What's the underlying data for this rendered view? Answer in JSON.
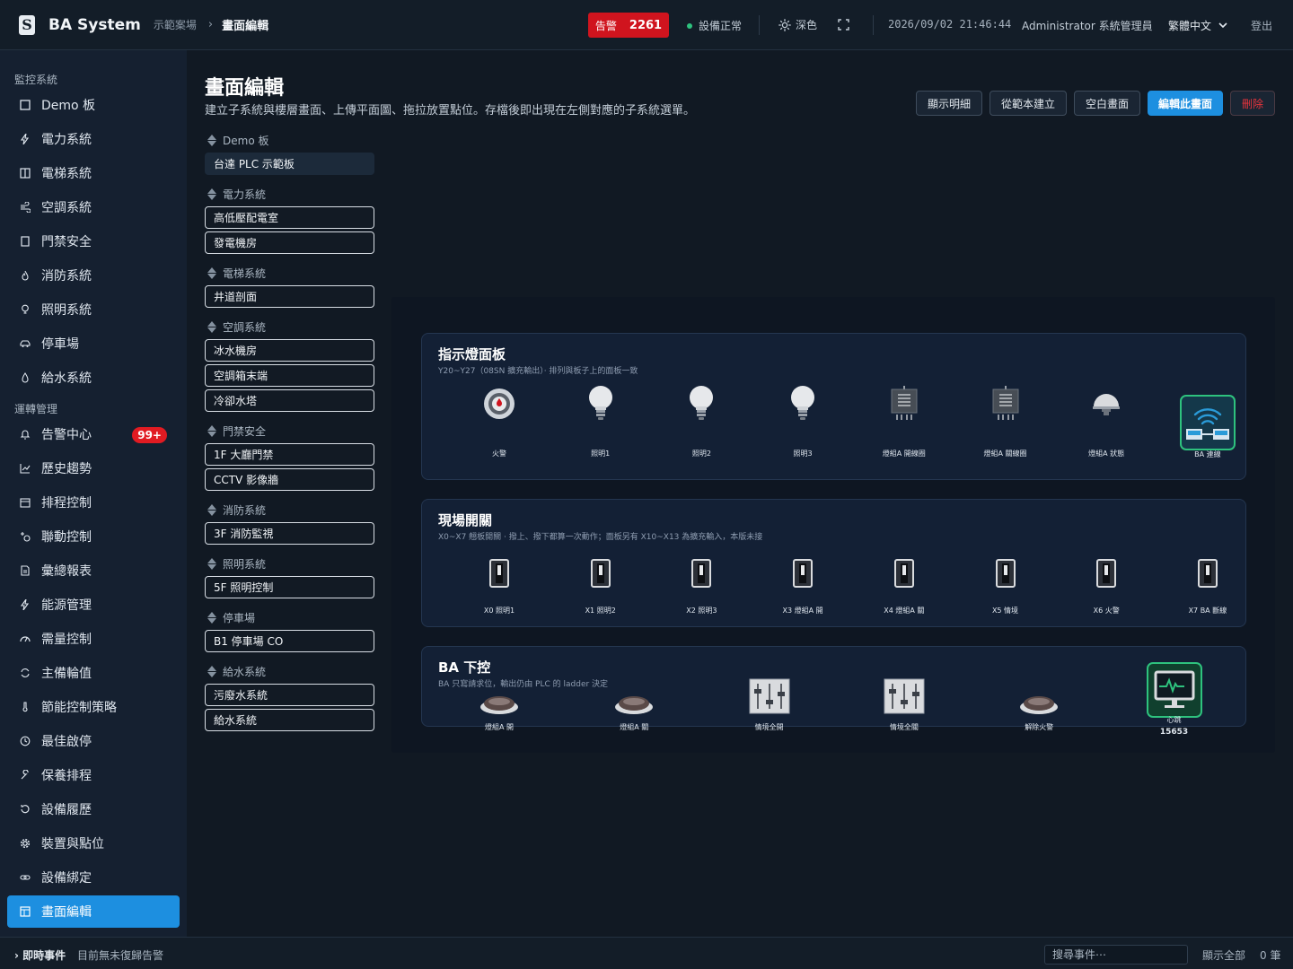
{
  "header": {
    "brand": "BA System",
    "breadcrumb": [
      "示範案場",
      "畫面編輯"
    ],
    "alarm_label": "告警",
    "alarm_count": "2261",
    "device_status": "設備正常",
    "theme_label": "深色",
    "datetime": "2026/09/02 21:46:44",
    "user": "Administrator 系統管理員",
    "language": "繁體中文",
    "logout": "登出"
  },
  "sidebar": {
    "groups": [
      {
        "title": "監控系統",
        "items": [
          {
            "label": "Demo 板",
            "icon": "square-icon"
          },
          {
            "label": "電力系統",
            "icon": "lightning-icon"
          },
          {
            "label": "電梯系統",
            "icon": "elevator-icon"
          },
          {
            "label": "空調系統",
            "icon": "wind-icon"
          },
          {
            "label": "門禁安全",
            "icon": "door-icon"
          },
          {
            "label": "消防系統",
            "icon": "flame-icon"
          },
          {
            "label": "照明系統",
            "icon": "bulb-icon"
          },
          {
            "label": "停車場",
            "icon": "car-icon"
          },
          {
            "label": "給水系統",
            "icon": "droplet-icon"
          }
        ]
      },
      {
        "title": "運轉管理",
        "items": [
          {
            "label": "告警中心",
            "icon": "bell-icon",
            "badge": "99+"
          },
          {
            "label": "歷史趨勢",
            "icon": "chart-icon"
          },
          {
            "label": "排程控制",
            "icon": "calendar-icon"
          },
          {
            "label": "聯動控制",
            "icon": "link-control-icon"
          },
          {
            "label": "彙總報表",
            "icon": "report-icon"
          },
          {
            "label": "能源管理",
            "icon": "lightning-icon"
          },
          {
            "label": "需量控制",
            "icon": "gauge-icon"
          },
          {
            "label": "主備輪值",
            "icon": "refresh-icon"
          },
          {
            "label": "節能控制策略",
            "icon": "thermometer-icon"
          },
          {
            "label": "最佳啟停",
            "icon": "clock-icon"
          },
          {
            "label": "保養排程",
            "icon": "wrench-icon"
          },
          {
            "label": "設備履歷",
            "icon": "history-icon"
          },
          {
            "label": "裝置與點位",
            "icon": "gear-icon"
          },
          {
            "label": "設備綁定",
            "icon": "chain-icon"
          },
          {
            "label": "畫面編輯",
            "icon": "layout-icon",
            "active": true
          }
        ]
      }
    ]
  },
  "page": {
    "title": "畫面編輯",
    "subtitle": "建立子系統與樓層畫面、上傳平面圖、拖拉放置點位。存檔後即出現在左側對應的子系統選單。",
    "toolbar": {
      "show_detail": "顯示明細",
      "from_template": "從範本建立",
      "blank_screen": "空白畫面",
      "edit_screen": "編輯此畫面",
      "delete": "刪除"
    }
  },
  "screen_groups": [
    {
      "title": "Demo 板",
      "pages": [
        "台達 PLC 示範板"
      ],
      "selected": 0
    },
    {
      "title": "電力系統",
      "pages": [
        "高低壓配電室",
        "發電機房"
      ]
    },
    {
      "title": "電梯系統",
      "pages": [
        "井道剖面"
      ]
    },
    {
      "title": "空調系統",
      "pages": [
        "冰水機房",
        "空調箱末端",
        "冷卻水塔"
      ]
    },
    {
      "title": "門禁安全",
      "pages": [
        "1F 大廳門禁",
        "CCTV 影像牆"
      ]
    },
    {
      "title": "消防系統",
      "pages": [
        "3F 消防監視"
      ]
    },
    {
      "title": "照明系統",
      "pages": [
        "5F 照明控制"
      ]
    },
    {
      "title": "停車場",
      "pages": [
        "B1 停車場 CO"
      ]
    },
    {
      "title": "給水系統",
      "pages": [
        "污廢水系統",
        "給水系統"
      ]
    }
  ],
  "preview": {
    "panels": [
      {
        "title": "指示燈面板",
        "subtitle": "Y20~Y27（08SN 擴充輸出）· 排列與板子上的面板一致",
        "devices": [
          {
            "label": "火警",
            "icon": "fire-alarm-icon"
          },
          {
            "label": "照明1",
            "icon": "bulb-icon"
          },
          {
            "label": "照明2",
            "icon": "bulb-icon"
          },
          {
            "label": "照明3",
            "icon": "bulb-icon"
          },
          {
            "label": "燈組A 開線圈",
            "icon": "coil-icon"
          },
          {
            "label": "燈組A 關線圈",
            "icon": "coil-icon"
          },
          {
            "label": "燈組A 狀態",
            "icon": "ceiling-lamp-icon"
          },
          {
            "label": "BA 連線",
            "icon": "network-link-icon"
          }
        ]
      },
      {
        "title": "現場開關",
        "subtitle": "X0~X7 翹板開關 · 撥上、撥下都算一次動作；面板另有 X10~X13 為擴充輸入，本版未接",
        "devices": [
          {
            "label": "X0 照明1",
            "icon": "toggle-switch-icon"
          },
          {
            "label": "X1 照明2",
            "icon": "toggle-switch-icon"
          },
          {
            "label": "X2 照明3",
            "icon": "toggle-switch-icon"
          },
          {
            "label": "X3 燈組A 開",
            "icon": "toggle-switch-icon"
          },
          {
            "label": "X4 燈組A 關",
            "icon": "toggle-switch-icon"
          },
          {
            "label": "X5 情境",
            "icon": "toggle-switch-icon"
          },
          {
            "label": "X6 火警",
            "icon": "toggle-switch-icon"
          },
          {
            "label": "X7 BA 斷線",
            "icon": "toggle-switch-icon"
          }
        ]
      },
      {
        "title": "BA 下控",
        "subtitle": "BA 只寫請求位，輸出仍由 PLC 的 ladder 決定",
        "devices": [
          {
            "label": "燈組A 開",
            "icon": "push-button-icon"
          },
          {
            "label": "燈組A 關",
            "icon": "push-button-icon"
          },
          {
            "label": "情境全開",
            "icon": "slider-panel-icon"
          },
          {
            "label": "情境全關",
            "icon": "slider-panel-icon"
          },
          {
            "label": "解除火警",
            "icon": "push-button-icon"
          },
          {
            "label": "心跳",
            "icon": "heartbeat-monitor-icon",
            "value": "15653"
          }
        ]
      }
    ]
  },
  "statusbar": {
    "title": "即時事件",
    "message": "目前無未復歸告警",
    "search_placeholder": "搜尋事件⋯",
    "show_all": "顯示全部",
    "count": "0 筆"
  }
}
